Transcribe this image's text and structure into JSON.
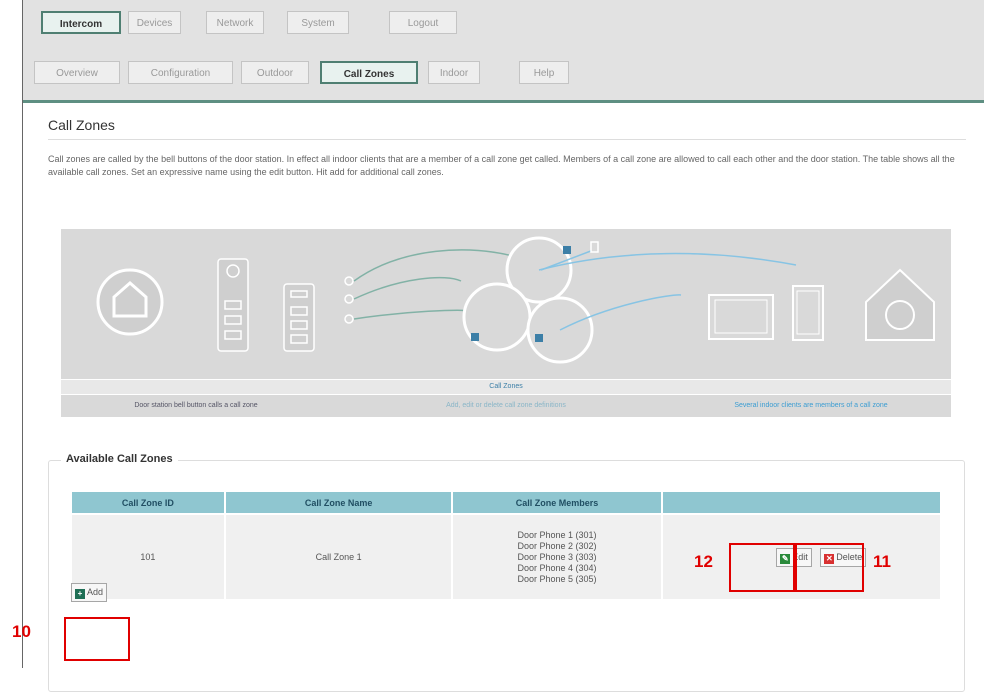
{
  "topnav": {
    "tabs": [
      "Intercom",
      "Devices",
      "Network",
      "System",
      "Logout"
    ]
  },
  "subnav": {
    "tabs": [
      "Overview",
      "Configuration",
      "Outdoor",
      "Call Zones",
      "Indoor",
      "Help"
    ]
  },
  "page": {
    "title": "Call Zones",
    "description": "Call zones are called by the bell buttons of the door station. In effect all indoor clients that are a member of a call zone get called. Members of a call zone are allowed to call each other and the door station. The table shows all the available call zones. Set an expressive name using the edit button. Hit add for additional call zones."
  },
  "diagram": {
    "caption": "Call Zones",
    "left_text": "Door station bell button calls a call zone",
    "middle_text": "Add, edit or delete call zone definitions",
    "right_text": "Several indoor clients are members of a call zone"
  },
  "available": {
    "legend": "Available Call Zones",
    "headers": [
      "Call Zone ID",
      "Call Zone Name",
      "Call Zone Members",
      ""
    ],
    "rows": [
      {
        "id": "101",
        "name": "Call Zone 1",
        "members": [
          "Door Phone 1 (301)",
          "Door Phone 2 (302)",
          "Door Phone 3 (303)",
          "Door Phone 4 (304)",
          "Door Phone 5 (305)"
        ]
      }
    ],
    "edit_label": "Edit",
    "delete_label": "Delete",
    "add_label": "Add"
  },
  "annotations": {
    "a10": "10",
    "a11": "11",
    "a12": "12"
  },
  "colors": {
    "accent": "#5e8f82",
    "table_header": "#8fc6d0",
    "annotation": "#e00000",
    "diagram_blue": "#3c7fa7"
  },
  "icons": [
    "edit-icon",
    "delete-icon",
    "add-icon",
    "house-icon",
    "door-station-icon",
    "circle-zone-icon",
    "tablet-icon",
    "phone-icon"
  ]
}
